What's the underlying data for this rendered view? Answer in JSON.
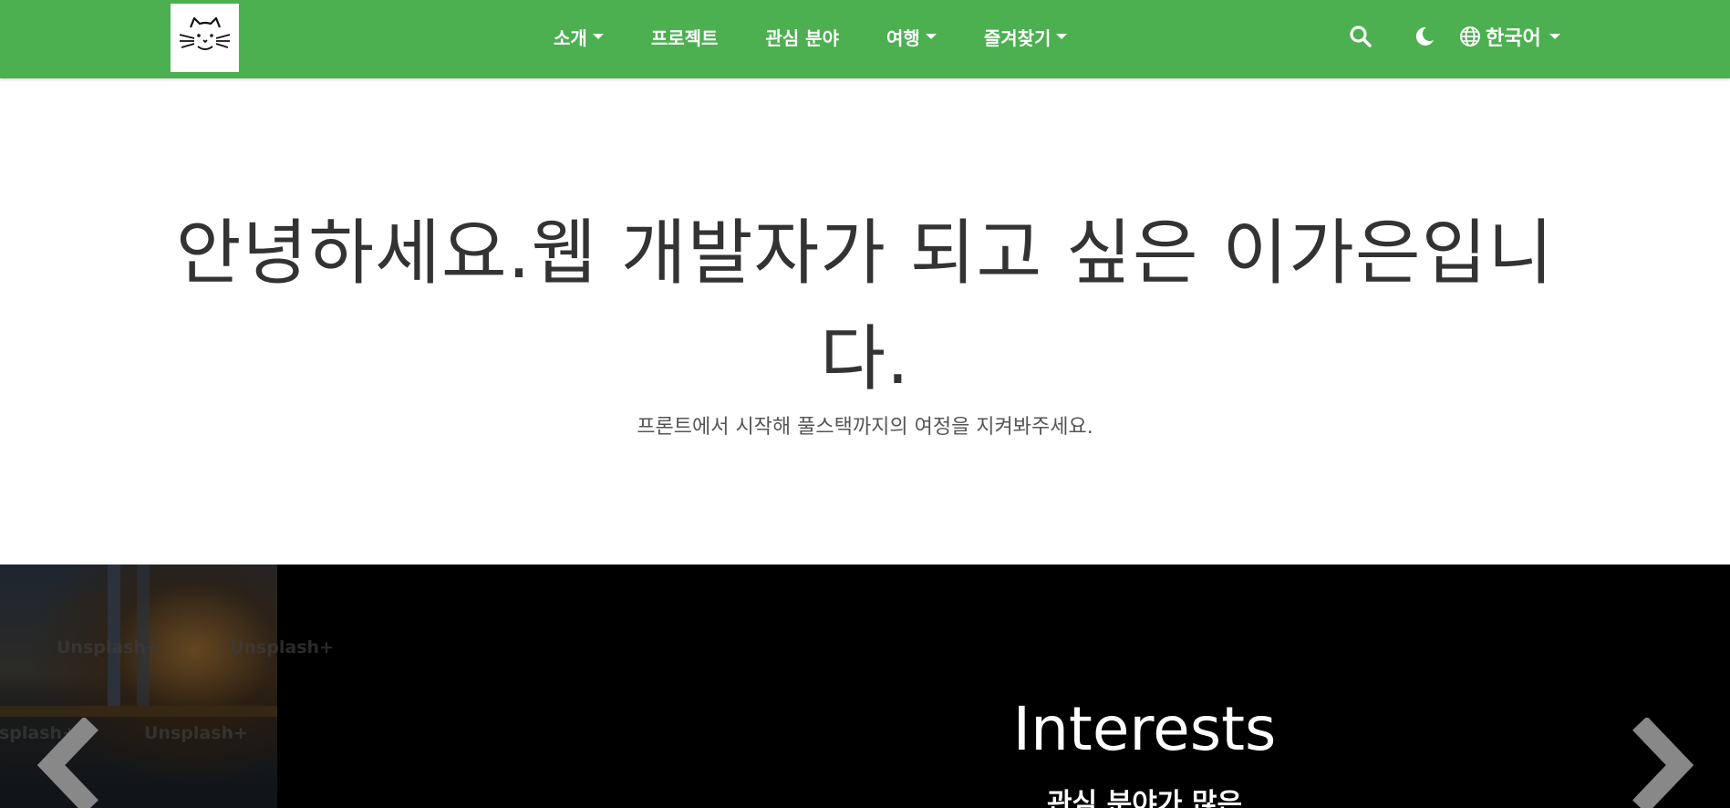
{
  "navbar": {
    "logo_alt": "cat logo",
    "menu": [
      {
        "label": "소개",
        "has_dropdown": true
      },
      {
        "label": "프로젝트",
        "has_dropdown": false
      },
      {
        "label": "관심 분야",
        "has_dropdown": false
      },
      {
        "label": "여행",
        "has_dropdown": true
      },
      {
        "label": "즐겨찾기",
        "has_dropdown": true
      }
    ],
    "search_icon": "search-icon",
    "theme_icon": "moon-icon",
    "language": {
      "label": "한국어",
      "icon": "globe-icon"
    }
  },
  "hero": {
    "title": "안녕하세요.웹 개발자가 되고 싶은 이가은입니다.",
    "subtitle": "프론트에서 시작해 풀스택까지의 여정을 지켜봐주세요."
  },
  "slider": {
    "watermark": "Unsplash+",
    "slide_title": "Interests",
    "slide_subtitle": "관심 분야가 많은",
    "prev_icon": "chevron-left-icon",
    "next_icon": "chevron-right-icon"
  },
  "colors": {
    "navbar_bg": "#4caf50",
    "slider_bg": "#000000",
    "arrow": "#888888"
  }
}
